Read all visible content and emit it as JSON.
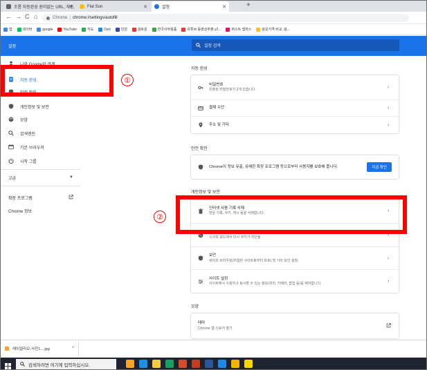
{
  "browser": {
    "tabs": [
      {
        "label": "조롱 자동완성 원이없는 URL, 자동…",
        "color": "#5f6368"
      },
      {
        "label": "Flat Sun",
        "color": "#fbbc04"
      },
      {
        "label": "설정",
        "color": "#1a73e8"
      }
    ],
    "new_tab": "+",
    "nav": {
      "back": "←",
      "forward": "→",
      "reload": "C",
      "home": "⌂"
    },
    "omnibox": {
      "host": "Chrome",
      "separator": "|",
      "path": "chrome://settings/autofill"
    },
    "bookmarks": [
      {
        "label": "앱",
        "color": "#4285f4"
      },
      {
        "label": "네이버",
        "color": "#03c75a"
      },
      {
        "label": "google",
        "color": "#4285f4"
      },
      {
        "label": "YouTube",
        "color": "#ff0000"
      },
      {
        "label": "지도",
        "color": "#34a853"
      },
      {
        "label": "Dart",
        "color": "#1e88e5"
      },
      {
        "label": "민원",
        "color": "#3949ab"
      },
      {
        "label": "검토원",
        "color": "#e53935"
      },
      {
        "label": "한국사무용품",
        "color": "#43a047"
      },
      {
        "label": "유튜브 동영상추출 y2...",
        "color": "#e53935"
      },
      {
        "label": "퀴스트 앱마스",
        "color": "#d81b60"
      },
      {
        "label": "광운가격 비교, 광...",
        "color": "#fbc02d"
      }
    ]
  },
  "header": {
    "title": "설정",
    "search_placeholder": "설정 검색"
  },
  "sidebar": {
    "items": [
      {
        "label": "나와 Google의 관계",
        "icon": "person-icon"
      },
      {
        "label": "자동 완성",
        "icon": "autofill-icon"
      },
      {
        "label": "안전 확인",
        "icon": "shield-check-icon"
      },
      {
        "label": "개인정보 및 보안",
        "icon": "shield-icon"
      },
      {
        "label": "모양",
        "icon": "palette-icon"
      },
      {
        "label": "검색엔진",
        "icon": "search-icon"
      },
      {
        "label": "기본 브라우저",
        "icon": "browser-icon"
      },
      {
        "label": "시작 그룹",
        "icon": "power-icon"
      }
    ],
    "advanced": "고급",
    "extensions": "확장 프로그램",
    "about": "Chrome 정보"
  },
  "main": {
    "autofill": {
      "title": "자동 완성",
      "rows": [
        {
          "title": "비밀번호",
          "subtitle": "유출된 비밀번호가 2개 있습니다.",
          "icon": "key-icon"
        },
        {
          "title": "결제 수단",
          "subtitle": "",
          "icon": "card-icon"
        },
        {
          "title": "주소 및 기타",
          "subtitle": "",
          "icon": "pin-icon"
        }
      ]
    },
    "safety": {
      "title": "안전 확인",
      "text": "Chrome이 정보 유출, 유해한 확장 프로그램 등으로부터 사용자를 보호해 줍니다.",
      "button": "지금 확인"
    },
    "privacy": {
      "title": "개인정보 및 보안",
      "rows": [
        {
          "title": "인터넷 사용 기록 삭제",
          "subtitle": "방문 기록, 쿠키, 캐시 등을 삭제합니다.",
          "icon": "trash-icon"
        },
        {
          "title": "쿠키 및 기타 사이트 데이터",
          "subtitle": "시크릿 모드에서 타사 쿠키가 차단됨",
          "icon": "cookie-icon"
        },
        {
          "title": "보안",
          "subtitle": "세이프 브라우징(위험한 사이트로부터 보호) 및 기타 보안 설정",
          "icon": "shield-icon"
        },
        {
          "title": "사이트 설정",
          "subtitle": "사이트에서 사용하고 표시할 수 있는 정보(위치, 카메라, 팝업 등)를 제어합니다.",
          "icon": "sliders-icon"
        }
      ]
    },
    "appearance": {
      "title": "모양",
      "rows": [
        {
          "title": "테마",
          "subtitle": "Chrome 웹 스토어 열기",
          "icon": "external-link-icon"
        }
      ]
    }
  },
  "annotations": {
    "first": "①",
    "second": "②",
    "color": "#ff0000"
  },
  "download": {
    "filename": "레이얼리오-사진1....jpg",
    "caret": "^"
  },
  "taskbar": {
    "search_placeholder": "검색하려면 여기에 입력하십시오.",
    "apps": [
      "#f4a42a",
      "#1e8fe1",
      "#f7c948",
      "#18a05e",
      "#d44c2e",
      "#c43b1d",
      "#2b579a",
      "#1e88e5",
      "#f4b400",
      "#ffd400"
    ]
  }
}
